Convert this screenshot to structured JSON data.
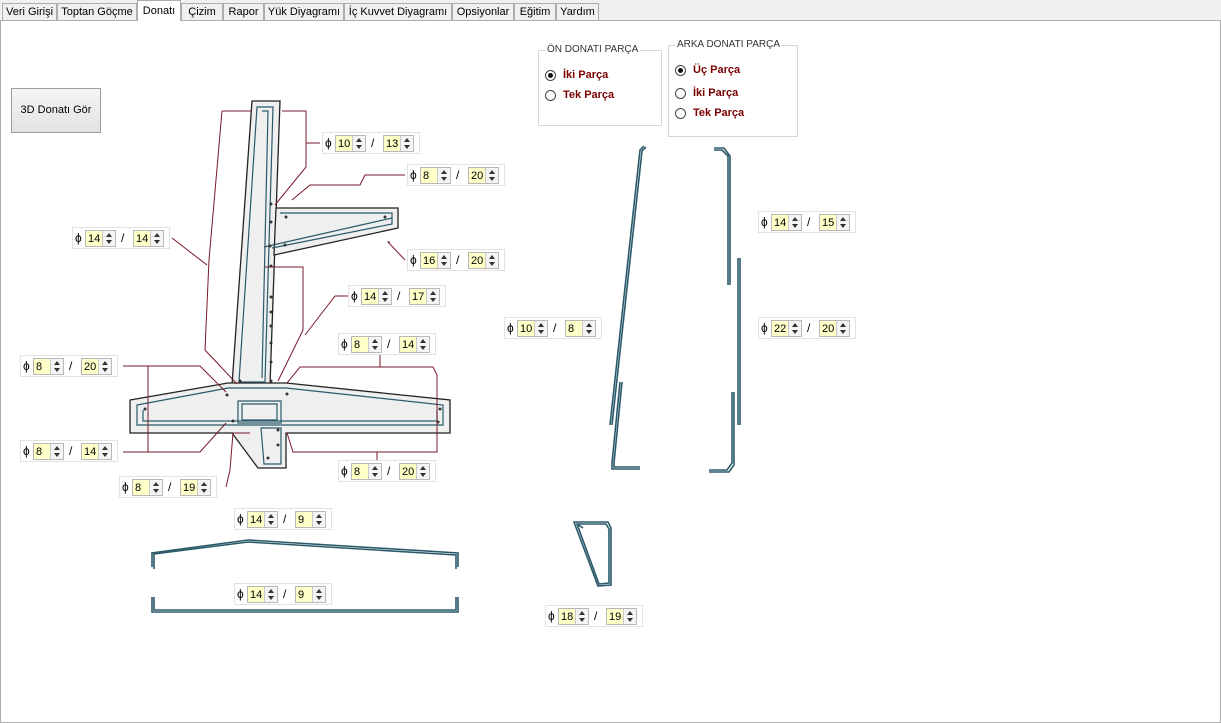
{
  "tabs": [
    "Veri Girişi",
    "Toptan Göçme",
    "Donatı",
    "Çizim",
    "Rapor",
    "Yük Diyagramı",
    "İç Kuvvet Diyagramı",
    "Opsiyonlar",
    "Eğitim",
    "Yardım"
  ],
  "active_tab": "Donatı",
  "button_3d": "3D Donatı Gör",
  "symbols": {
    "phi": "ϕ",
    "slash": "/"
  },
  "on_group": {
    "title": "ÖN DONATI PARÇA",
    "options": [
      "İki Parça",
      "Tek Parça"
    ],
    "selected": 0
  },
  "arka_group": {
    "title": "ARKA DONATI PARÇA",
    "options": [
      "Üç Parça",
      "İki Parça",
      "Tek Parça"
    ],
    "selected": 0
  },
  "rebars": [
    {
      "d": "10",
      "s": "13"
    },
    {
      "d": "8",
      "s": "20"
    },
    {
      "d": "14",
      "s": "14"
    },
    {
      "d": "16",
      "s": "20"
    },
    {
      "d": "14",
      "s": "17"
    },
    {
      "d": "8",
      "s": "14"
    },
    {
      "d": "8",
      "s": "20"
    },
    {
      "d": "8",
      "s": "14"
    },
    {
      "d": "8",
      "s": "20"
    },
    {
      "d": "8",
      "s": "19"
    },
    {
      "d": "14",
      "s": "9"
    },
    {
      "d": "14",
      "s": "9"
    },
    {
      "d": "10",
      "s": "8"
    },
    {
      "d": "14",
      "s": "15"
    },
    {
      "d": "22",
      "s": "20"
    },
    {
      "d": "18",
      "s": "19"
    }
  ]
}
